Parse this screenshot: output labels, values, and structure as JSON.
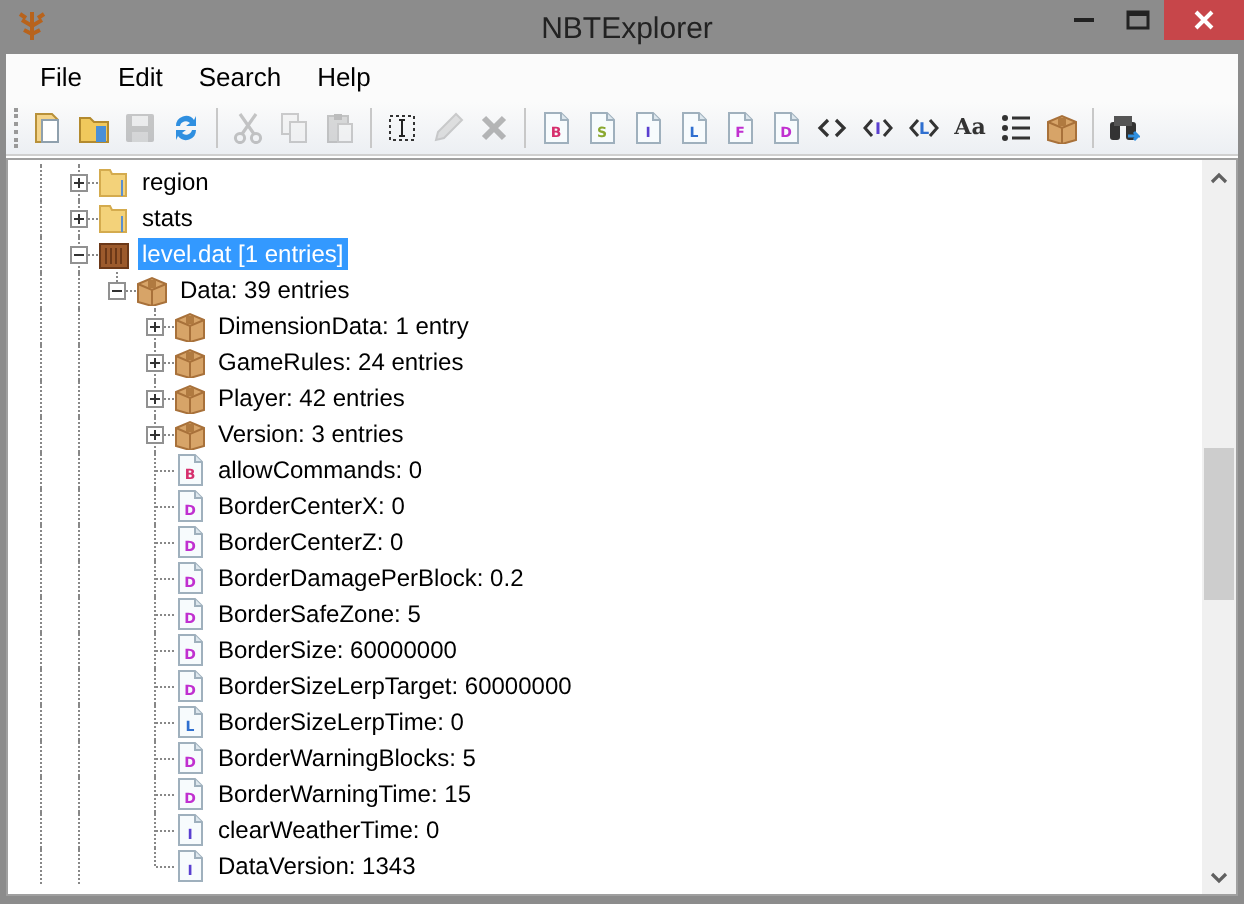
{
  "window": {
    "title": "NBTExplorer"
  },
  "menu": [
    "File",
    "Edit",
    "Search",
    "Help"
  ],
  "toolbar": [
    {
      "kind": "open-file",
      "disabled": false
    },
    {
      "kind": "open-folder",
      "disabled": false
    },
    {
      "kind": "save",
      "disabled": true
    },
    {
      "kind": "refresh",
      "disabled": false
    },
    {
      "kind": "separator"
    },
    {
      "kind": "cut",
      "disabled": true
    },
    {
      "kind": "copy",
      "disabled": true
    },
    {
      "kind": "paste",
      "disabled": true
    },
    {
      "kind": "separator"
    },
    {
      "kind": "rename",
      "disabled": false
    },
    {
      "kind": "edit",
      "disabled": true
    },
    {
      "kind": "delete",
      "disabled": true
    },
    {
      "kind": "separator"
    },
    {
      "kind": "tag",
      "letter": "B",
      "color": "#d6306e",
      "disabled": false
    },
    {
      "kind": "tag",
      "letter": "S",
      "color": "#8aa830",
      "disabled": false
    },
    {
      "kind": "tag",
      "letter": "I",
      "color": "#5a3fd0",
      "disabled": false
    },
    {
      "kind": "tag",
      "letter": "L",
      "color": "#2f6fd0",
      "disabled": false
    },
    {
      "kind": "tag",
      "letter": "F",
      "color": "#c030d0",
      "disabled": false
    },
    {
      "kind": "tag",
      "letter": "D",
      "color": "#c030d0",
      "disabled": false
    },
    {
      "kind": "brackets",
      "disabled": false
    },
    {
      "kind": "int-array",
      "letter": "I",
      "disabled": false
    },
    {
      "kind": "long-array",
      "letter": "L",
      "disabled": false
    },
    {
      "kind": "glyph",
      "glyph": "Aa",
      "disabled": false
    },
    {
      "kind": "list",
      "disabled": false
    },
    {
      "kind": "compound",
      "disabled": false
    },
    {
      "kind": "separator"
    },
    {
      "kind": "find",
      "disabled": false
    }
  ],
  "tree": [
    {
      "label": "region",
      "kind": "folder",
      "expanded": false,
      "selected": false
    },
    {
      "label": "stats",
      "kind": "folder",
      "expanded": false,
      "selected": false
    },
    {
      "label": "level.dat [1 entries]",
      "kind": "file",
      "expanded": true,
      "selected": true,
      "children": [
        {
          "label": "Data: 39 entries",
          "kind": "compound",
          "expanded": true,
          "selected": false,
          "children": [
            {
              "label": "DimensionData: 1 entry",
              "kind": "compound",
              "expanded": false,
              "selected": false
            },
            {
              "label": "GameRules: 24 entries",
              "kind": "compound",
              "expanded": false,
              "selected": false
            },
            {
              "label": "Player: 42 entries",
              "kind": "compound",
              "expanded": false,
              "selected": false
            },
            {
              "label": "Version: 3 entries",
              "kind": "compound",
              "expanded": false,
              "selected": false
            },
            {
              "label": "allowCommands: 0",
              "kind": "tag",
              "tag": "B",
              "color": "#d6306e",
              "selected": false
            },
            {
              "label": "BorderCenterX: 0",
              "kind": "tag",
              "tag": "D",
              "color": "#c030d0",
              "selected": false
            },
            {
              "label": "BorderCenterZ: 0",
              "kind": "tag",
              "tag": "D",
              "color": "#c030d0",
              "selected": false
            },
            {
              "label": "BorderDamagePerBlock: 0.2",
              "kind": "tag",
              "tag": "D",
              "color": "#c030d0",
              "selected": false
            },
            {
              "label": "BorderSafeZone: 5",
              "kind": "tag",
              "tag": "D",
              "color": "#c030d0",
              "selected": false
            },
            {
              "label": "BorderSize: 60000000",
              "kind": "tag",
              "tag": "D",
              "color": "#c030d0",
              "selected": false
            },
            {
              "label": "BorderSizeLerpTarget: 60000000",
              "kind": "tag",
              "tag": "D",
              "color": "#c030d0",
              "selected": false
            },
            {
              "label": "BorderSizeLerpTime: 0",
              "kind": "tag",
              "tag": "L",
              "color": "#2f6fd0",
              "selected": false
            },
            {
              "label": "BorderWarningBlocks: 5",
              "kind": "tag",
              "tag": "D",
              "color": "#c030d0",
              "selected": false
            },
            {
              "label": "BorderWarningTime: 15",
              "kind": "tag",
              "tag": "D",
              "color": "#c030d0",
              "selected": false
            },
            {
              "label": "clearWeatherTime: 0",
              "kind": "tag",
              "tag": "I",
              "color": "#5a3fd0",
              "selected": false
            },
            {
              "label": "DataVersion: 1343",
              "kind": "tag",
              "tag": "I",
              "color": "#5a3fd0",
              "selected": false
            }
          ]
        }
      ]
    }
  ]
}
